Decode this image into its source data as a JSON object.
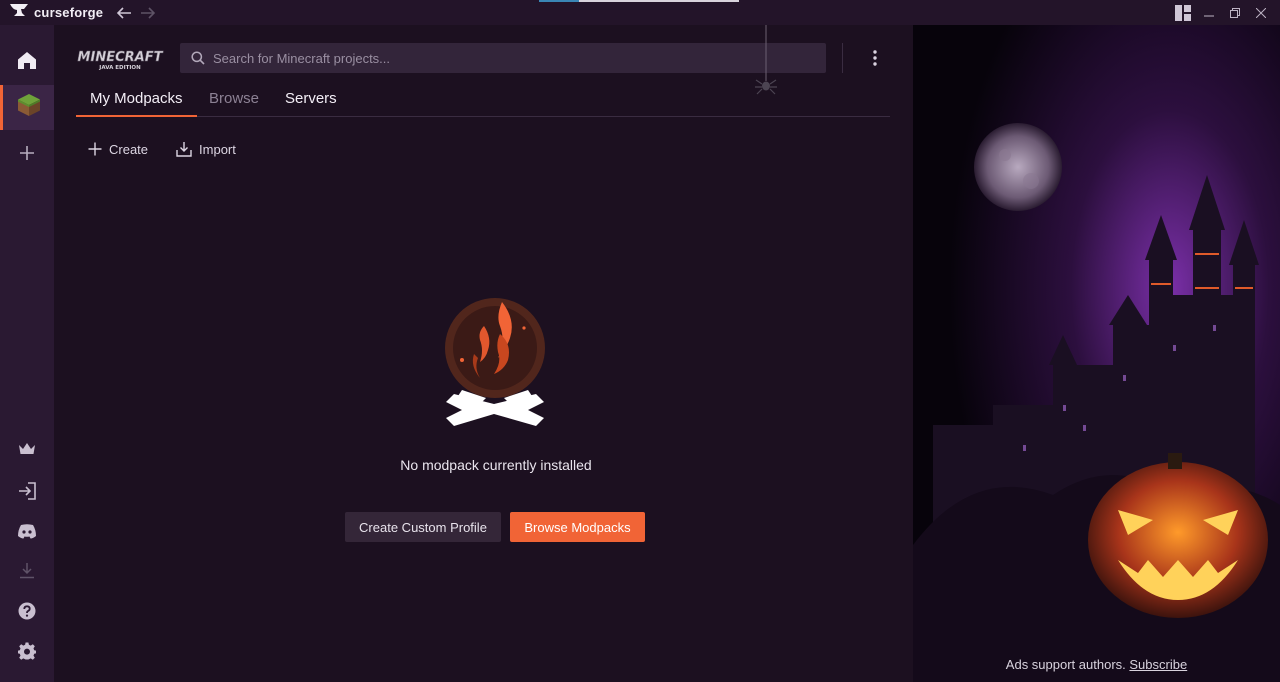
{
  "app": {
    "title": "curseforge"
  },
  "colors": {
    "accent": "#f16436",
    "background": "#1c1020",
    "sidebar": "#2a1932"
  },
  "sidebar": {
    "items": [
      {
        "icon": "home-icon"
      },
      {
        "icon": "minecraft-grass-block-icon"
      },
      {
        "icon": "plus-icon"
      },
      {
        "icon": "crown-icon"
      },
      {
        "icon": "login-icon"
      },
      {
        "icon": "discord-icon"
      },
      {
        "icon": "download-icon"
      },
      {
        "icon": "help-icon"
      },
      {
        "icon": "settings-icon"
      }
    ]
  },
  "header": {
    "game_logo": "MINECRAFT",
    "game_logo_sub": "JAVA EDITION",
    "search_placeholder": "Search for Minecraft projects..."
  },
  "tabs": [
    {
      "label": "My Modpacks"
    },
    {
      "label": "Browse"
    },
    {
      "label": "Servers"
    }
  ],
  "actions": {
    "create_label": "Create",
    "import_label": "Import"
  },
  "empty_state": {
    "message": "No modpack currently installed",
    "create_custom_profile": "Create Custom Profile",
    "browse_modpacks": "Browse Modpacks"
  },
  "ad": {
    "text": "Ads support authors.",
    "subscribe": "Subscribe"
  }
}
